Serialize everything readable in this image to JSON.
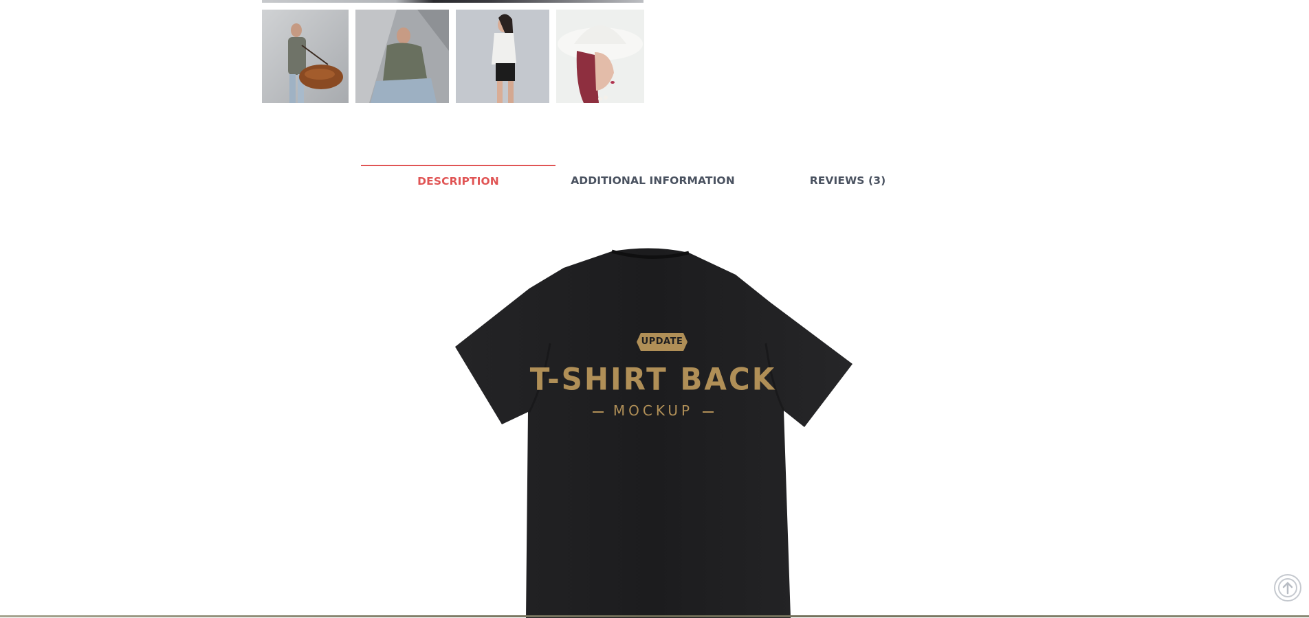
{
  "gallery": {
    "thumbnails": [
      {
        "alt": "man-with-leather-bag"
      },
      {
        "alt": "man-sitting"
      },
      {
        "alt": "woman-in-white-top"
      },
      {
        "alt": "woman-in-sun-hat"
      }
    ]
  },
  "tabs": {
    "items": [
      {
        "label": "DESCRIPTION",
        "active": true
      },
      {
        "label": "ADDITIONAL INFORMATION",
        "active": false
      },
      {
        "label": "REVIEWS (3)",
        "active": false
      }
    ]
  },
  "description": {
    "shirt_badge": "UPDATE",
    "shirt_title": "T-SHIRT BACK",
    "shirt_subtitle": "MOCKUP"
  },
  "colors": {
    "accent": "#e05454",
    "tab_text": "#4a5260",
    "gold_print": "#b08f57",
    "shirt": "#1e1e20"
  },
  "icons": {
    "scroll_top": "arrow-up-circle-icon"
  }
}
